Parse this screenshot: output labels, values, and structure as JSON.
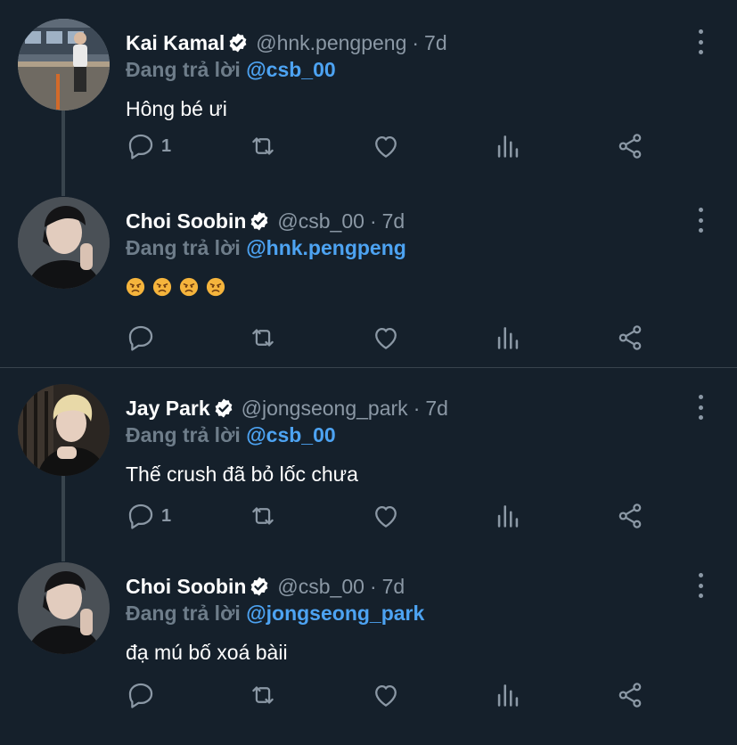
{
  "colors": {
    "background": "#15202b",
    "divider": "#38444d",
    "secondary_text": "#8b98a5",
    "mention": "#4da3f2",
    "verified": "#ffffff"
  },
  "threads": [
    {
      "tweets": [
        {
          "avatar_icon": "user-photo-standing-by-train",
          "name": "Kai Kamal",
          "handle": "@hnk.pengpeng",
          "dot": "·",
          "time": "7d",
          "replying_prefix": "Đang trả lời",
          "replying_to": "@csb_00",
          "text": "Hông bé ưi",
          "reply_count": "1"
        },
        {
          "avatar_icon": "user-photo-dark-hair",
          "name": "Choi Soobin",
          "handle": "@csb_00",
          "dot": "·",
          "time": "7d",
          "replying_prefix": "Đang trả lời",
          "replying_to": "@hnk.pengpeng",
          "emojis": [
            "angry-face-emoji",
            "angry-face-emoji",
            "angry-face-emoji",
            "angry-face-emoji"
          ],
          "reply_count": ""
        }
      ]
    },
    {
      "tweets": [
        {
          "avatar_icon": "user-photo-blonde-hair",
          "name": "Jay Park",
          "handle": "@jongseong_park",
          "dot": "·",
          "time": "7d",
          "replying_prefix": "Đang trả lời",
          "replying_to": "@csb_00",
          "text": "Thế crush đã bỏ lốc chưa",
          "reply_count": "1"
        },
        {
          "avatar_icon": "user-photo-dark-hair",
          "name": "Choi Soobin",
          "handle": "@csb_00",
          "dot": "·",
          "time": "7d",
          "replying_prefix": "Đang trả lời",
          "replying_to": "@jongseong_park",
          "text": "đạ mú bố xoá bàii",
          "reply_count": ""
        }
      ]
    }
  ],
  "action_icons": [
    "reply-icon",
    "retweet-icon",
    "like-icon",
    "analytics-icon",
    "share-icon"
  ]
}
